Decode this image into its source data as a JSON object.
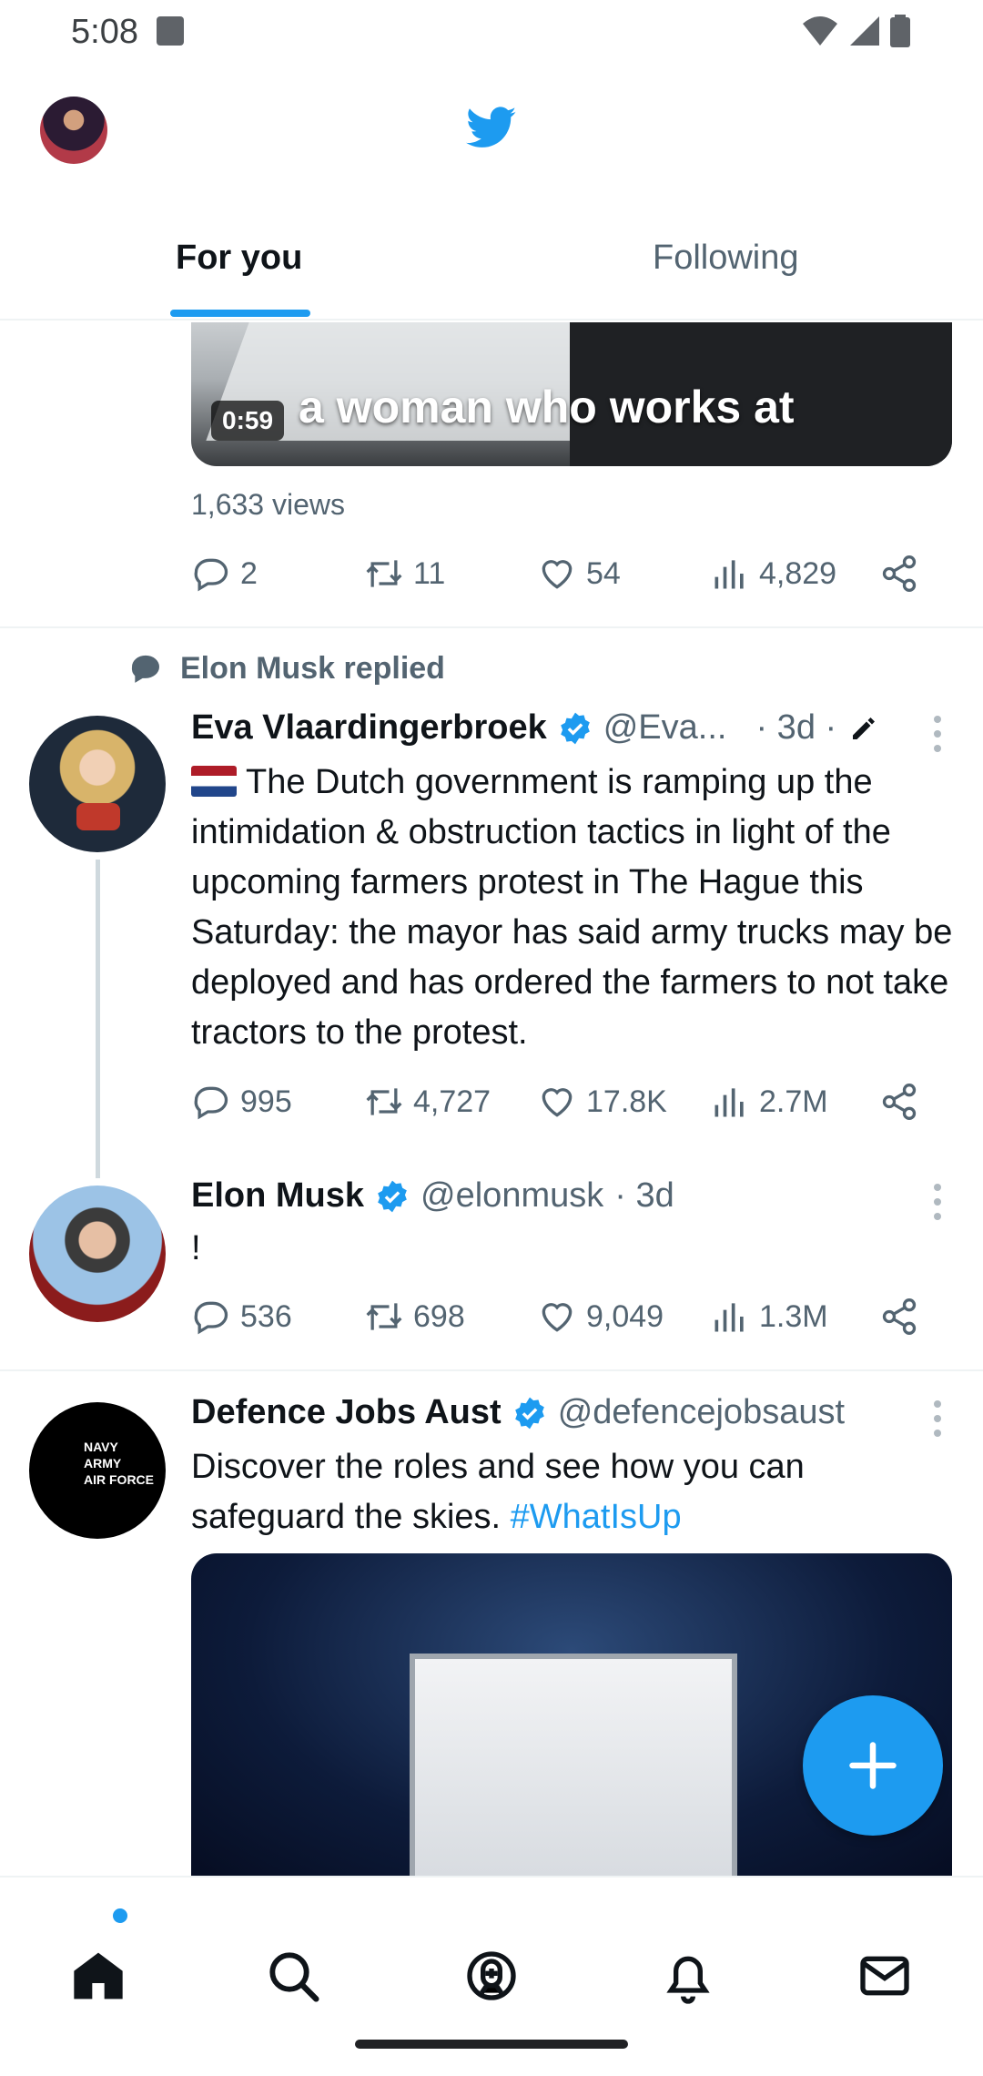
{
  "status_bar": {
    "time": "5:08"
  },
  "tabs": [
    {
      "label": "For you",
      "active": true
    },
    {
      "label": "Following",
      "active": false
    }
  ],
  "post1": {
    "video_caption": "a woman who works at",
    "duration": "0:59",
    "views": "1,633 views",
    "replies": "2",
    "retweets": "11",
    "likes": "54",
    "impressions": "4,829"
  },
  "context": {
    "text": "Elon Musk replied"
  },
  "post2": {
    "name": "Eva Vlaardingerbroek",
    "handle": "@Eva...",
    "time": "· 3d ·",
    "text": "The Dutch government is ramping up the intimidation & obstruction tactics in light of the upcoming farmers protest in The Hague this Saturday: the mayor has said army trucks may be deployed and has ordered the farmers to not take tractors to the protest.",
    "replies": "995",
    "retweets": "4,727",
    "likes": "17.8K",
    "impressions": "2.7M"
  },
  "post3": {
    "name": "Elon Musk",
    "handle": "@elonmusk",
    "time": "· 3d",
    "text": "!",
    "replies": "536",
    "retweets": "698",
    "likes": "9,049",
    "impressions": "1.3M"
  },
  "post4": {
    "name": "Defence Jobs Aust",
    "handle": "@defencejobsaust",
    "text": "Discover the roles and see how you can safeguard the skies. ",
    "hashtag": "#WhatIsUp",
    "avatar_text": [
      "NAVY",
      "ARMY",
      "AIR FORCE"
    ]
  },
  "colors": {
    "accent": "#1d9bf0",
    "text": "#0f1419",
    "muted": "#536471"
  },
  "icons": [
    "twitter-bird-icon",
    "reply-icon",
    "retweet-icon",
    "like-icon",
    "views-icon",
    "share-icon",
    "verified-icon",
    "more-icon",
    "compose-icon",
    "home-icon",
    "search-icon",
    "spaces-icon",
    "notifications-icon",
    "messages-icon"
  ]
}
